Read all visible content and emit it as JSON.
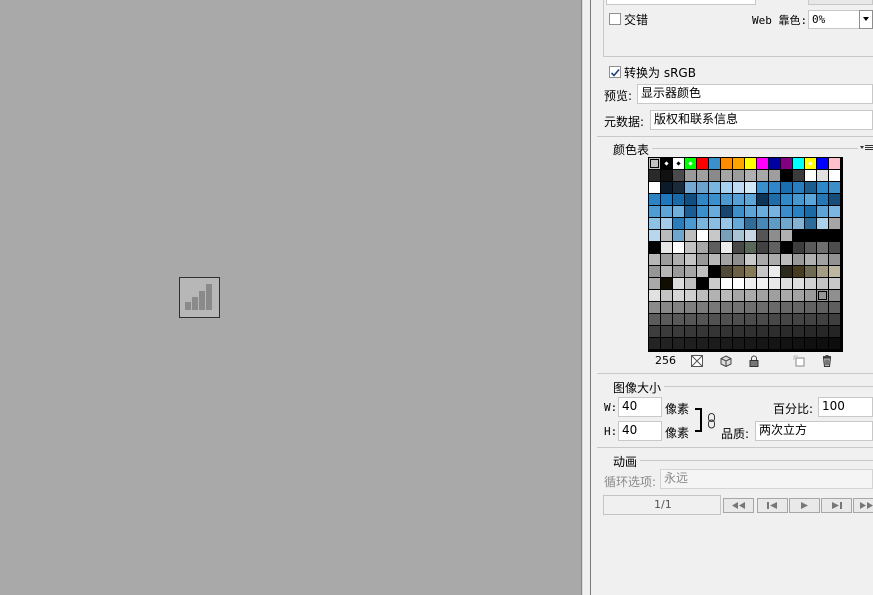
{
  "export_settings": {
    "interlaced_label": "交错",
    "web_snap_label": "Web 靠色:",
    "web_snap_value": "0%",
    "convert_srgb_label": "转换为 sRGB",
    "convert_srgb_checked": true,
    "preview_label": "预览:",
    "preview_value": "显示器颜色",
    "metadata_label": "元数据:",
    "metadata_value": "版权和联系信息"
  },
  "color_table": {
    "title": "颜色表",
    "count": "256",
    "swatches": [
      [
        "#c0c0c0",
        "#000000",
        "#ffffff",
        "#00ff00",
        "#ff0000",
        "#3a8fcd",
        "#ff8c00",
        "#ffa500",
        "#ffff00",
        "#ff00ff",
        "#0000a0",
        "#800080",
        "#00ffff",
        "#ffff00",
        "#0000ff",
        "#ffc0cb"
      ],
      [
        "#2a2a2a",
        "#111111",
        "#4a4a4a",
        "#9a9a9a",
        "#a0a0a0",
        "#8a8a8a",
        "#a5a5a5",
        "#9c9c9c",
        "#b0b0b0",
        "#a8a8a8",
        "#9e9e9e",
        "#000000",
        "#3a3a3a",
        "#ffffff",
        "#e0e0e0",
        "#ffffff"
      ],
      [
        "#ffffff",
        "#0b1b2a",
        "#1a2a3a",
        "#73a9d2",
        "#6aa3d0",
        "#78b5e0",
        "#a8d0f0",
        "#c0dcf2",
        "#d5e8f6",
        "#3a8fcd",
        "#2f86c8",
        "#1a6fb0",
        "#2a7ebd",
        "#1d5d8e",
        "#2c88c9",
        "#3d8fc8"
      ],
      [
        "#2d84c5",
        "#1f78bb",
        "#1a6aa8",
        "#114e80",
        "#2f87c7",
        "#3a8fcd",
        "#4d9ad2",
        "#56a0d5",
        "#5fa6d8",
        "#0c3558",
        "#1e6ca8",
        "#3089c9",
        "#4698d2",
        "#5aa5d9",
        "#2677b6",
        "#184d7a"
      ],
      [
        "#4f9bd3",
        "#5ea4d7",
        "#70afdc",
        "#1b5d92",
        "#3a8fcd",
        "#69abda",
        "#18456d",
        "#3d8fca",
        "#5da4d7",
        "#6aaddc",
        "#76b3de",
        "#3c8ccb",
        "#2b80c2",
        "#1a6aa6",
        "#5ea3d6",
        "#7ab6df"
      ],
      [
        "#8fc1e4",
        "#a4cce9",
        "#2b7cba",
        "#4b99d2",
        "#7bb5de",
        "#89bde2",
        "#97c5e6",
        "#66a9d9",
        "#336b97",
        "#4887b6",
        "#5f9bc4",
        "#71a7cd",
        "#86b3d3",
        "#2f6b99",
        "#aed1ea",
        "#a6a6a6"
      ],
      [
        "#b8d6ec",
        "#bababa",
        "#6ea5cd",
        "#bdbdbd",
        "#ffffff",
        "#c8c8c8",
        "#7a9fb8",
        "#a9c3d6",
        "#c6d6e2",
        "#555555",
        "#8d8d8d",
        "#b1b1b1",
        "#000000",
        "#000000",
        "#000000",
        "#000000"
      ],
      [
        "#000000",
        "#e6e6e6",
        "#ffffff",
        "#c2c2c2",
        "#a7a7a7",
        "#5e5e5e",
        "#ececec",
        "#474747",
        "#596858",
        "#424242",
        "#616161",
        "#000000",
        "#3d3d3d",
        "#5a5a5a",
        "#6e6e6e",
        "#4d4d4d"
      ],
      [
        "#b6b6b6",
        "#9b9b9b",
        "#aeaeae",
        "#c4c4c4",
        "#989898",
        "#b8b8b8",
        "#a3a3a3",
        "#8e8e8e",
        "#c9c9c9",
        "#a9a9a9",
        "#ababab",
        "#bcbcbc",
        "#999999",
        "#b0b0b0",
        "#a1a1a1",
        "#929292"
      ],
      [
        "#969696",
        "#b5b5b5",
        "#9a9a9a",
        "#a6a6a6",
        "#c0c0c0",
        "#000000",
        "#4f4a3a",
        "#6c6047",
        "#867a58",
        "#c6c6c6",
        "#ececec",
        "#2c2a1c",
        "#473c20",
        "#6f6a52",
        "#a59d83",
        "#bdb7a2"
      ],
      [
        "#a9a9a9",
        "#110d03",
        "#dddddd",
        "#bfbfbf",
        "#000000",
        "#cbcbcb",
        "#ffffff",
        "#ffffff",
        "#efefef",
        "#f2f2f2",
        "#e8e8e8",
        "#dddddd",
        "#dfdfdf",
        "#d1d1d1",
        "#c4c4c4",
        "#c8c8c8"
      ],
      [
        "#e1e1e1",
        "#c3c3c3",
        "#d6d6d6",
        "#cfcfcf",
        "#bcbcbc",
        "#b2b2b2",
        "#b9b9b9",
        "#a7a7a7",
        "#ababab",
        "#a2a2a2",
        "#9f9f9f",
        "#a9a9a9",
        "#a3a3a3",
        "#9b9b9b",
        "#959595",
        "#8f8f8f"
      ],
      [
        "#8b8b8b",
        "#878787",
        "#828282",
        "#7f7f7f",
        "#7b7b7b",
        "#787878",
        "#757575",
        "#727272",
        "#6f6f6f",
        "#6c6c6c",
        "#6a6a6a",
        "#676767",
        "#656565",
        "#626262",
        "#606060",
        "#5e5e5e"
      ],
      [
        "#5c5c5c",
        "#5a5a5a",
        "#585858",
        "#565656",
        "#545454",
        "#525252",
        "#505050",
        "#4e4e4e",
        "#4c4c4c",
        "#4a4a4a",
        "#484848",
        "#464646",
        "#444444",
        "#434343",
        "#414141",
        "#3f3f3f"
      ],
      [
        "#3d3d3d",
        "#3b3b3b",
        "#3a3a3a",
        "#383838",
        "#363636",
        "#353535",
        "#333333",
        "#313131",
        "#303030",
        "#2e2e2e",
        "#2d2d2d",
        "#2b2b2b",
        "#2a2a2a",
        "#282828",
        "#272727",
        "#252525"
      ],
      [
        "#242424",
        "#222222",
        "#212121",
        "#1f1f1f",
        "#1e1e1e",
        "#1c1c1c",
        "#1b1b1b",
        "#191919",
        "#181818",
        "#161616",
        "#151515",
        "#131313",
        "#121212",
        "#101010",
        "#0f0f0f",
        "#0d0d0d"
      ]
    ]
  },
  "image_size": {
    "title": "图像大小",
    "w_label": "W:",
    "w_value": "40",
    "w_unit": "像素",
    "h_label": "H:",
    "h_value": "40",
    "h_unit": "像素",
    "percent_label": "百分比:",
    "percent_value": "100",
    "quality_label": "品质:",
    "quality_value": "两次立方"
  },
  "animation": {
    "title": "动画",
    "loop_label": "循环选项:",
    "loop_value": "永远",
    "frame_counter": "1/1"
  }
}
